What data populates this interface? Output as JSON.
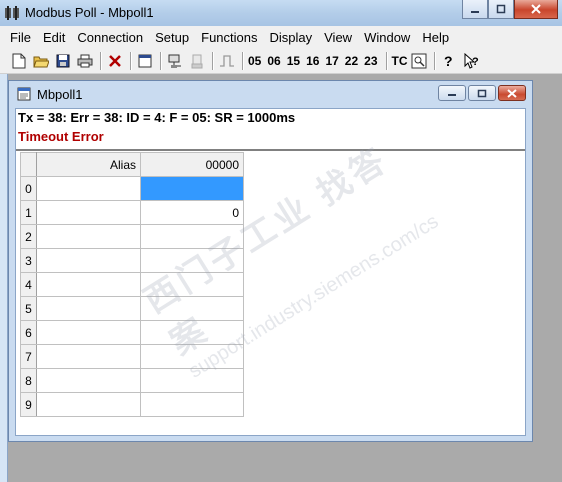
{
  "app": {
    "title": "Modbus Poll - Mbpoll1",
    "menu": [
      "File",
      "Edit",
      "Connection",
      "Setup",
      "Functions",
      "Display",
      "View",
      "Window",
      "Help"
    ]
  },
  "toolbar": {
    "function_codes": [
      "05",
      "06",
      "15",
      "16",
      "17",
      "22",
      "23"
    ],
    "tc_label": "TC"
  },
  "child": {
    "title": "Mbpoll1",
    "status": "Tx = 38: Err = 38: ID = 4: F = 05: SR = 1000ms",
    "error": "Timeout Error",
    "grid": {
      "headers": {
        "alias": "Alias",
        "value": "00000"
      },
      "rows": [
        {
          "num": "0",
          "alias": "",
          "value": ""
        },
        {
          "num": "1",
          "alias": "",
          "value": "0"
        },
        {
          "num": "2",
          "alias": "",
          "value": ""
        },
        {
          "num": "3",
          "alias": "",
          "value": ""
        },
        {
          "num": "4",
          "alias": "",
          "value": ""
        },
        {
          "num": "5",
          "alias": "",
          "value": ""
        },
        {
          "num": "6",
          "alias": "",
          "value": ""
        },
        {
          "num": "7",
          "alias": "",
          "value": ""
        },
        {
          "num": "8",
          "alias": "",
          "value": ""
        },
        {
          "num": "9",
          "alias": "",
          "value": ""
        }
      ]
    }
  },
  "watermark": {
    "line1": "西门子工业  找答案",
    "line2": "support.industry.siemens.com/cs"
  },
  "colors": {
    "selection": "#3399ff",
    "error": "#b00000"
  }
}
